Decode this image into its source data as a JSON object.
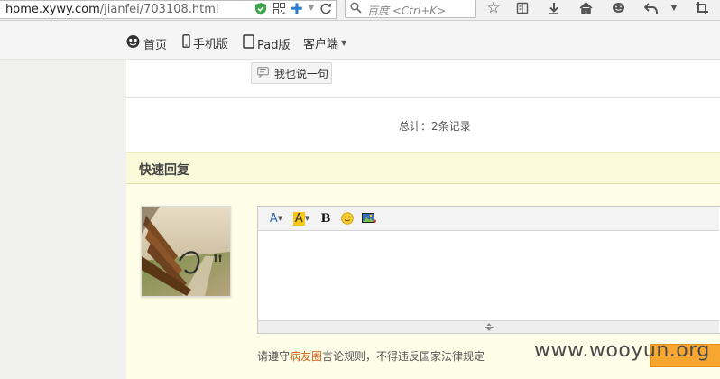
{
  "browser": {
    "url_domain": "home.xywy.com",
    "url_path": "/jianfei/703108.html",
    "search_placeholder": "百度 <Ctrl+K>"
  },
  "site_nav": {
    "items": [
      {
        "label": "首页",
        "icon": "home-face-icon"
      },
      {
        "label": "手机版",
        "icon": "phone-icon"
      },
      {
        "label": "Pad版",
        "icon": "tablet-icon"
      },
      {
        "label": "客户端",
        "icon": "dropdown-caret"
      }
    ]
  },
  "comments": {
    "say_button_label": "我也说一句",
    "total_text": "总计：2条记录"
  },
  "quick_reply": {
    "title": "快速回复",
    "toolbar": [
      {
        "name": "font-color-icon",
        "glyph": "A"
      },
      {
        "name": "highlight-icon",
        "glyph": "A"
      },
      {
        "name": "bold-icon",
        "glyph": "B"
      },
      {
        "name": "emoji-icon",
        "glyph": "☺"
      },
      {
        "name": "insert-image-icon",
        "glyph": "▣"
      }
    ],
    "editor_value": "",
    "rules_prefix": "请遵守",
    "rules_link": "病友圈",
    "rules_suffix": "言论规则，不得违反国家法律规定"
  },
  "watermark": "www.wooyun.org",
  "colors": {
    "accent_orange": "#f7a62f",
    "quick_reply_bg": "#fbfad8",
    "link_orange": "#d0621a"
  }
}
